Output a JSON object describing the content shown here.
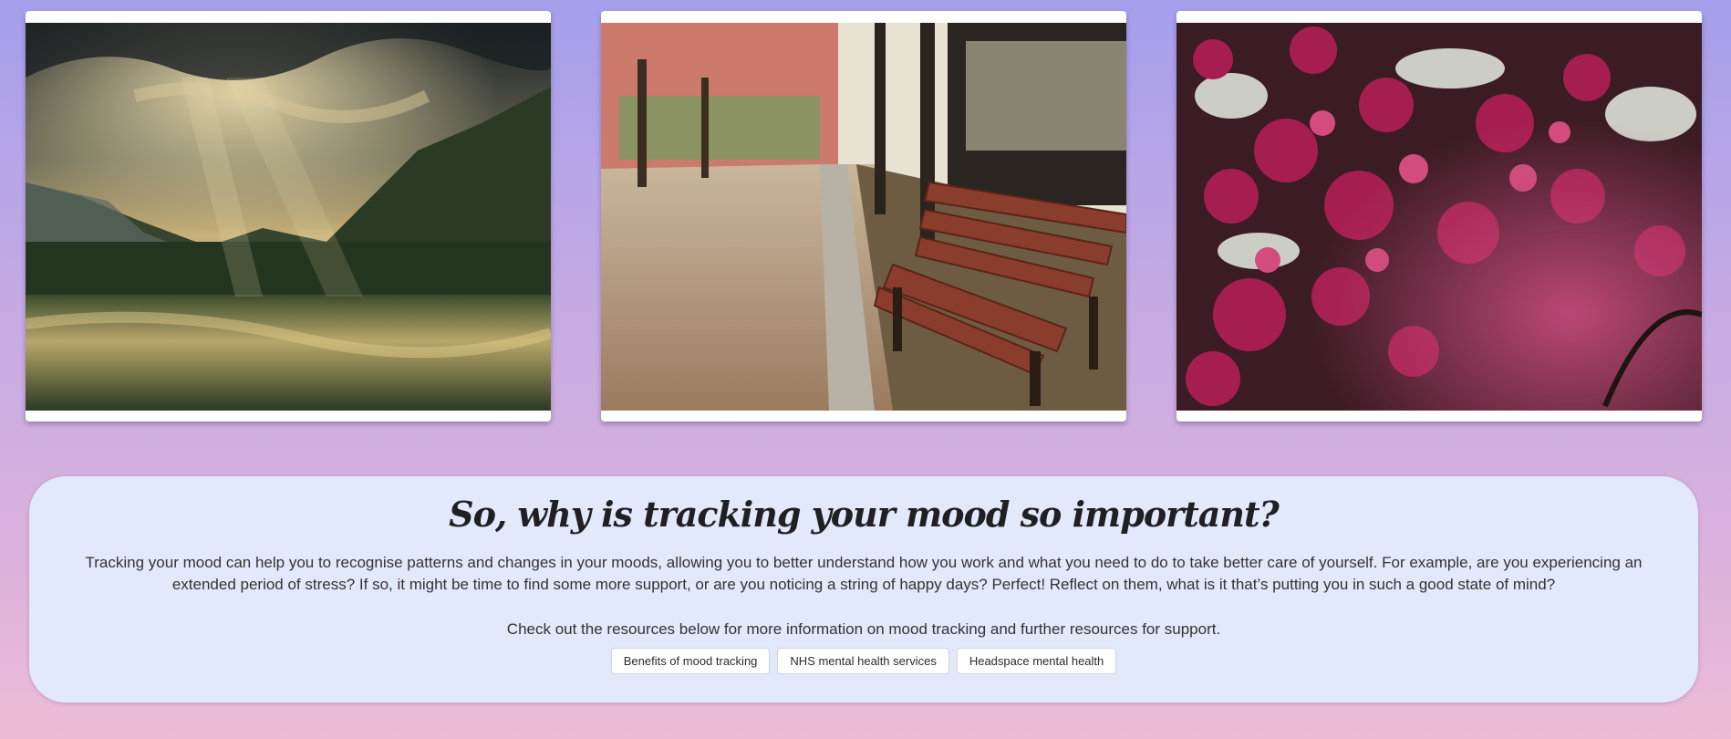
{
  "gallery": {
    "images": [
      {
        "subject": "mountain lake with sun rays through clouds"
      },
      {
        "subject": "wooden park bench on autumn path"
      },
      {
        "subject": "pink blossom flowers close-up"
      }
    ]
  },
  "info": {
    "title": "So, why is tracking your mood so important?",
    "body": "Tracking your mood can help you to recognise patterns and changes in your moods, allowing you to better understand how you work and what you need to do to take better care of yourself. For example, are you experiencing an extended period of stress? If so, it might be time to find some more support, or are you noticing a string of happy days? Perfect! Reflect on them, what is it that’s putting you in such a good state of mind?",
    "cta": "Check out the resources below for more information on mood tracking and further resources for support.",
    "links": [
      {
        "label": "Benefits of mood tracking"
      },
      {
        "label": "NHS mental health services"
      },
      {
        "label": "Headspace mental health"
      }
    ]
  },
  "colors": {
    "background_top": "#a59fec",
    "background_bottom": "#edbbd6",
    "panel": "#e2e9fa"
  }
}
